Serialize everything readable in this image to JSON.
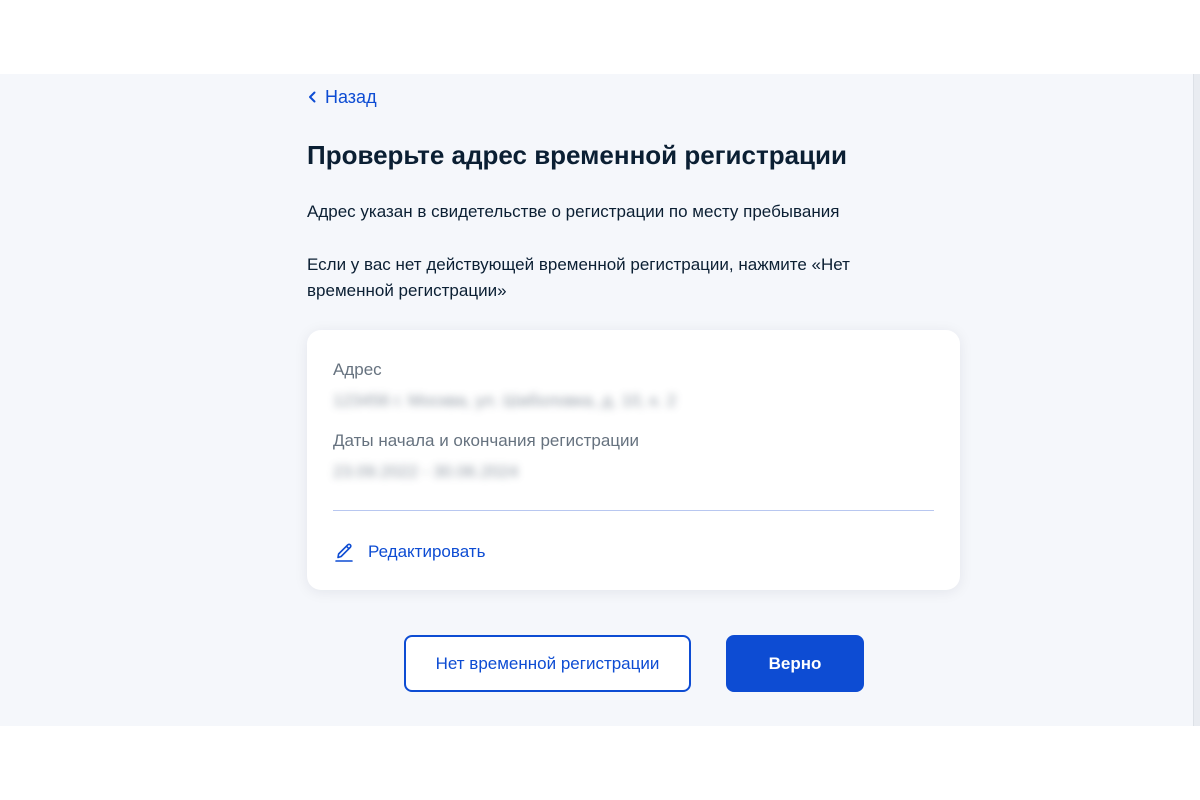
{
  "nav": {
    "back_label": "Назад"
  },
  "page": {
    "title": "Проверьте адрес временной регистрации",
    "description_1": "Адрес указан в свидетельстве о регистрации по месту пребывания",
    "description_2": "Если у вас нет действующей временной регистрации, нажмите «Нет временной регистрации»"
  },
  "card": {
    "address_label": "Адрес",
    "address_value": "123456 г. Москва, ул. Шаболовка, д. 10, к. 2",
    "dates_label": "Даты начала и окончания регистрации",
    "dates_value": "23.09.2022 - 30.06.2024",
    "edit_label": "Редактировать"
  },
  "actions": {
    "no_registration_label": "Нет временной регистрации",
    "confirm_label": "Верно"
  },
  "icons": {
    "back": "chevron-left-icon",
    "edit": "pencil-icon"
  },
  "colors": {
    "accent": "#0d4cd3",
    "page_background": "#f5f7fb",
    "card_background": "#ffffff",
    "text_primary": "#0b1f33",
    "text_secondary": "#66727f"
  }
}
